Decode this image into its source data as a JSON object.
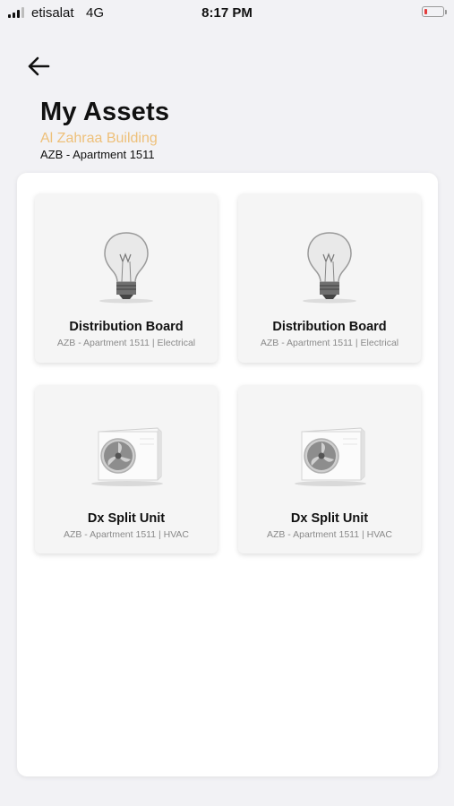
{
  "status_bar": {
    "carrier": "etisalat",
    "network": "4G",
    "time": "8:17 PM",
    "battery_color": "#e33c3c"
  },
  "header": {
    "back_icon": "arrow-left-icon",
    "title": "My Assets",
    "building": "Al Zahraa Building",
    "unit": "AZB - Apartment 1511",
    "building_color": "#eec07a"
  },
  "assets": [
    {
      "name": "Distribution Board",
      "details": "AZB - Apartment 1511 | Electrical",
      "icon": "light-bulb-icon"
    },
    {
      "name": "Distribution Board",
      "details": "AZB - Apartment 1511 | Electrical",
      "icon": "light-bulb-icon"
    },
    {
      "name": "Dx Split Unit",
      "details": "AZB - Apartment 1511 | HVAC",
      "icon": "ac-outdoor-unit-icon"
    },
    {
      "name": "Dx Split Unit",
      "details": "AZB - Apartment 1511 | HVAC",
      "icon": "ac-outdoor-unit-icon"
    }
  ]
}
